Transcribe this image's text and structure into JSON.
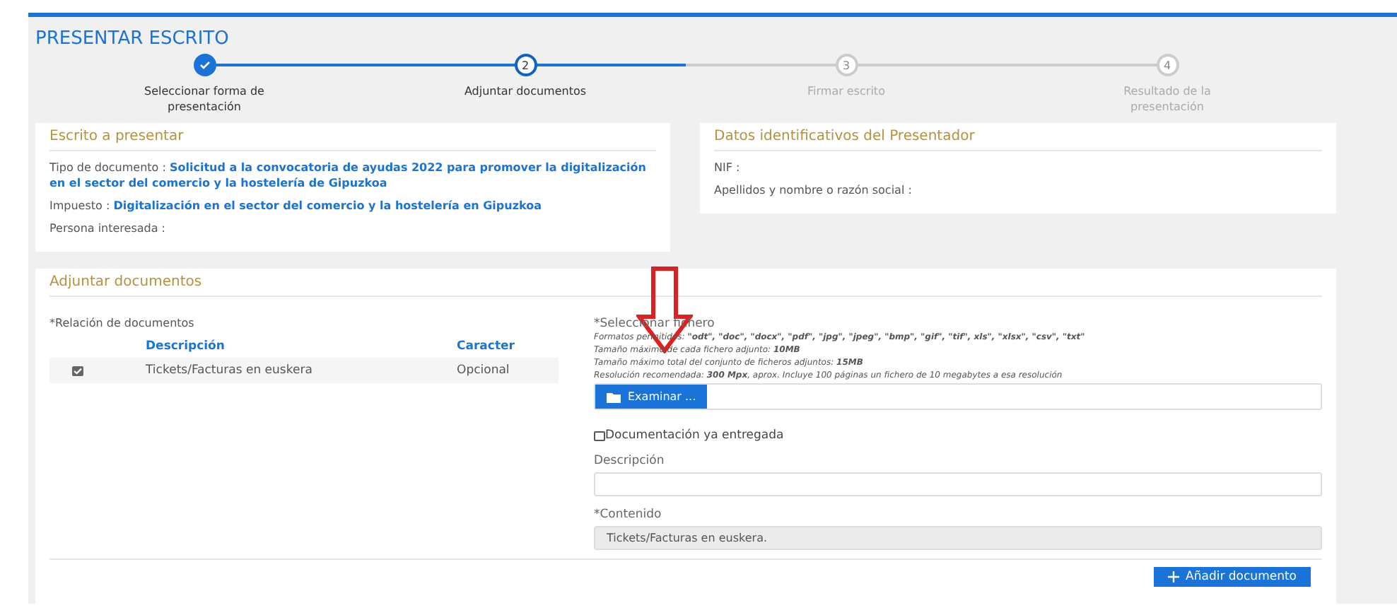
{
  "page_title": "PRESENTAR ESCRITO",
  "steps": [
    {
      "label": "Seleccionar forma de presentación",
      "done": true,
      "selected": false
    },
    {
      "number": "2",
      "label": "Adjuntar documentos",
      "done": false,
      "selected": true
    },
    {
      "number": "3",
      "label": "Firmar escrito",
      "done": false,
      "selected": false
    },
    {
      "number": "4",
      "label": "Resultado de la presentación",
      "done": false,
      "selected": false
    }
  ],
  "escrito": {
    "title": "Escrito a presentar",
    "fields": [
      {
        "label": "Tipo de documento :",
        "value": "Solicitud a la convocatoria de ayudas 2022 para promover la digitalización en el sector del comercio y la hostelería de Gipuzkoa"
      },
      {
        "label": "Impuesto :",
        "value": "Digitalización en el sector del comercio y la hostelería en Gipuzkoa"
      },
      {
        "label": "Persona interesada :"
      }
    ]
  },
  "presentador": {
    "title": "Datos identificativos del Presentador",
    "fields": [
      {
        "label": "NIF :"
      },
      {
        "label": "Apellidos y nombre o razón social :"
      }
    ]
  },
  "adjuntar": {
    "title": "Adjuntar documentos",
    "relacion_label": "*Relación de documentos",
    "columns": [
      "Descripción",
      "Caracter"
    ],
    "rows": [
      {
        "checked": true,
        "description": "Tickets/Facturas en euskera",
        "caracter": "Opcional"
      }
    ],
    "file_label": "*Seleccionar fichero",
    "hints": [
      "Formatos permitidos: **\"odt\", \"doc\", \"docx\", \"pdf\", \"jpg\", \"jpeg\", \"bmp\", \"gif\", \"tif\", xls\", \"xlsx\", \"csv\", \"txt\"**",
      "Tamaño máximo de cada fichero adjunto: **10MB**",
      "Tamaño máximo total del conjunto de ficheros adjuntos: **15MB**",
      "Resolución recomendada: **300 Mpx**, aprox. Incluye 100 páginas un fichero de 10 megabytes a esa resolución"
    ],
    "browse_button": "Examinar ...",
    "delivered": {
      "label": "Documentación ya entregada",
      "checked": false
    },
    "description_label": "Descripción",
    "content_label": "*Contenido",
    "content_value": "Tickets/Facturas en euskera.",
    "add_button": "Añadir documento"
  }
}
